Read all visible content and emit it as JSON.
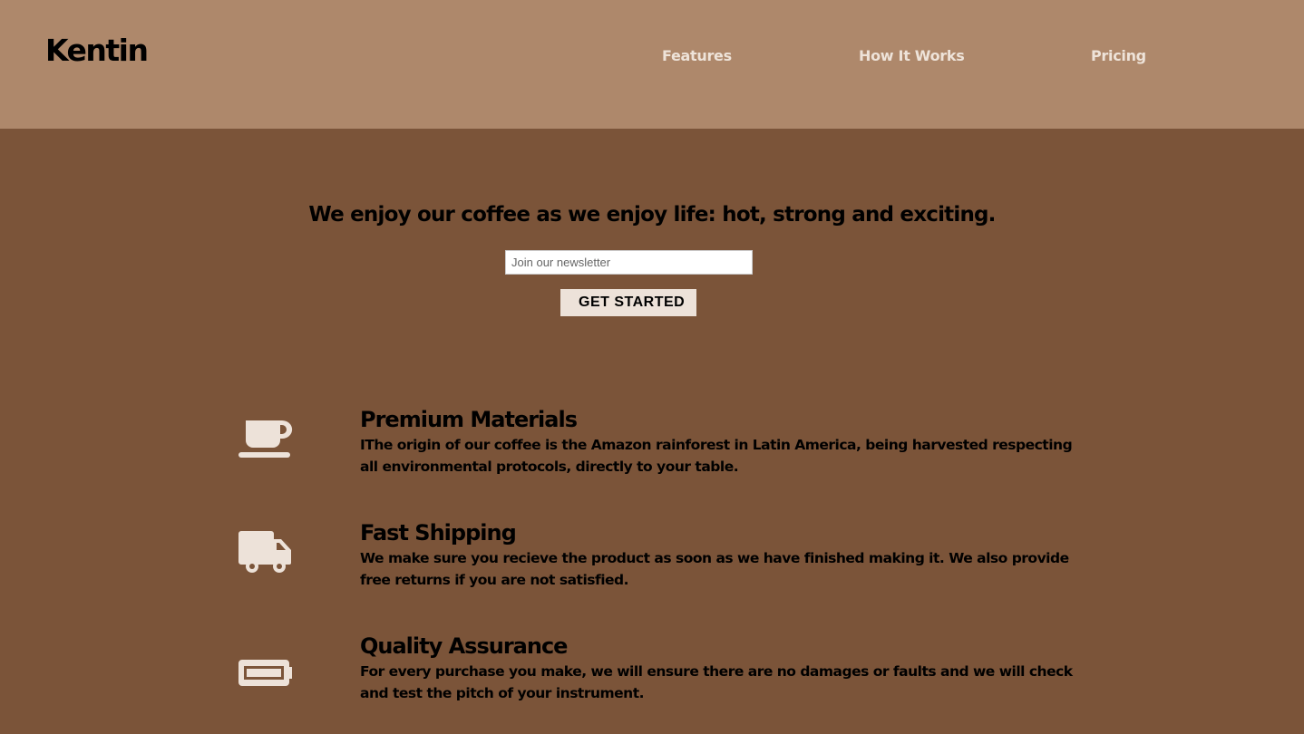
{
  "header": {
    "logo": "Kentin",
    "nav": [
      {
        "label": "Features"
      },
      {
        "label": "How It Works"
      },
      {
        "label": "Pricing"
      }
    ]
  },
  "hero": {
    "title": "We enjoy our coffee as we enjoy life: hot, strong and exciting.",
    "newsletter_placeholder": "Join our newsletter",
    "cta_label": "GET STARTED"
  },
  "features": [
    {
      "icon": "coffee-cup-icon",
      "title": "Premium Materials",
      "description": "IThe origin of our coffee is the Amazon rainforest in Latin America, being harvested respecting all environmental protocols, directly to your table."
    },
    {
      "icon": "truck-icon",
      "title": "Fast Shipping",
      "description": "We make sure you recieve the product as soon as we have finished making it. We also provide free returns if you are not satisfied."
    },
    {
      "icon": "battery-icon",
      "title": "Quality Assurance",
      "description": "For every purchase you make, we will ensure there are no damages or faults and we will check and test the pitch of your instrument."
    }
  ],
  "colors": {
    "header_bg": "#ae886b",
    "page_bg": "#7b5439",
    "accent_light": "#ede2d9"
  }
}
